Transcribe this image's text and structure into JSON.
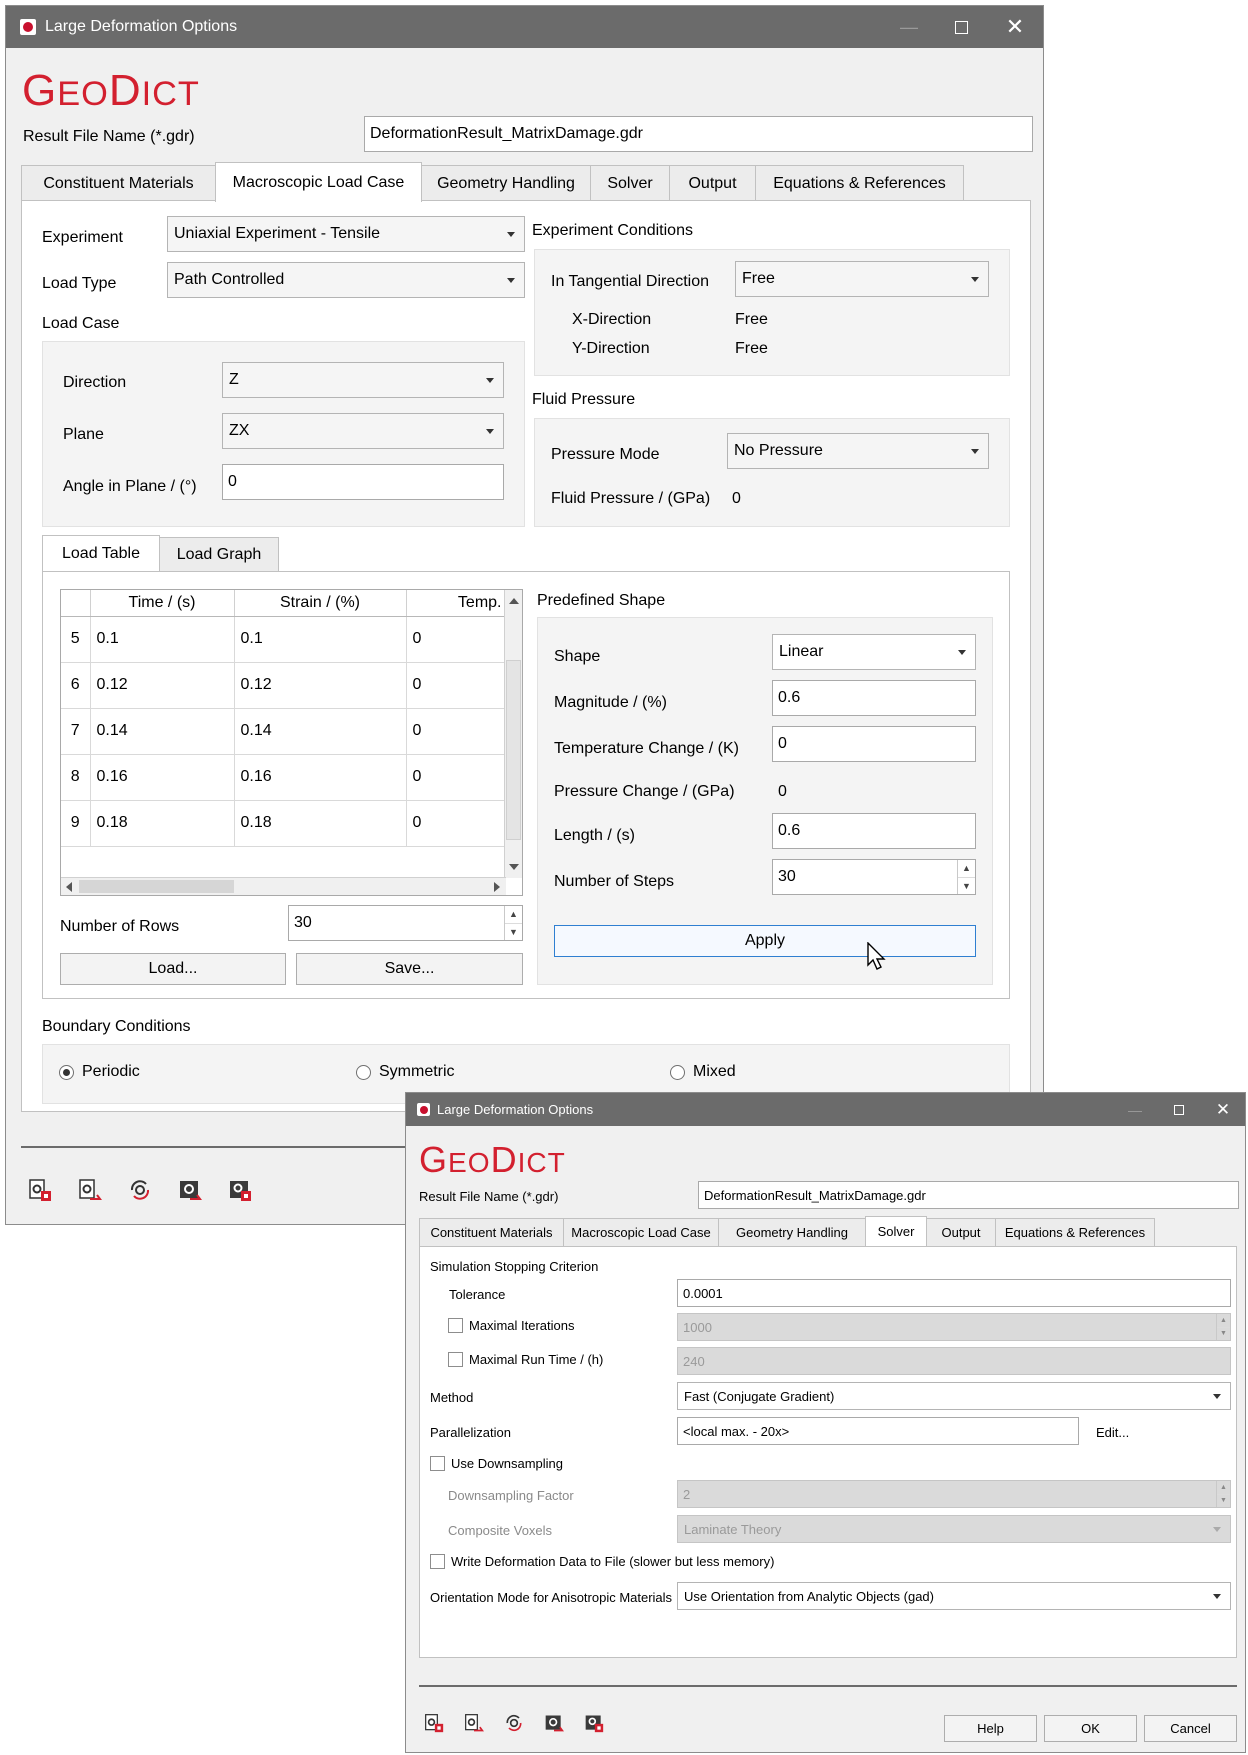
{
  "w1": {
    "title": "Large Deformation Options",
    "logo_big1": "G",
    "logo_small1": "EO",
    "logo_big2": "D",
    "logo_small2": "ICT",
    "result_file_label": "Result File Name (*.gdr)",
    "result_file_value": "DeformationResult_MatrixDamage.gdr",
    "tabs": [
      "Constituent Materials",
      "Macroscopic Load Case",
      "Geometry Handling",
      "Solver",
      "Output",
      "Equations & References"
    ],
    "experiment_label": "Experiment",
    "experiment_value": "Uniaxial Experiment - Tensile",
    "load_type_label": "Load Type",
    "load_type_value": "Path Controlled",
    "load_case_label": "Load Case",
    "direction_label": "Direction",
    "direction_value": "Z",
    "plane_label": "Plane",
    "plane_value": "ZX",
    "angle_label": "Angle in Plane / (°)",
    "angle_value": "0",
    "exp_conditions_label": "Experiment Conditions",
    "tangential_label": "In Tangential Direction",
    "tangential_value": "Free",
    "xdir_label": "X-Direction",
    "xdir_value": "Free",
    "ydir_label": "Y-Direction",
    "ydir_value": "Free",
    "fluid_pressure_group": "Fluid Pressure",
    "pressure_mode_label": "Pressure Mode",
    "pressure_mode_value": "No Pressure",
    "fluid_pressure_label": "Fluid Pressure / (GPa)",
    "fluid_pressure_value": "0",
    "subtabs": [
      "Load Table",
      "Load Graph"
    ],
    "table_headers": [
      "Time / (s)",
      "Strain / (%)",
      "Temp."
    ],
    "table_rows": [
      {
        "n": "5",
        "time": "0.1",
        "strain": "0.1",
        "temp": "0"
      },
      {
        "n": "6",
        "time": "0.12",
        "strain": "0.12",
        "temp": "0"
      },
      {
        "n": "7",
        "time": "0.14",
        "strain": "0.14",
        "temp": "0"
      },
      {
        "n": "8",
        "time": "0.16",
        "strain": "0.16",
        "temp": "0"
      },
      {
        "n": "9",
        "time": "0.18",
        "strain": "0.18",
        "temp": "0"
      }
    ],
    "rows_label": "Number of Rows",
    "rows_value": "30",
    "load_btn": "Load...",
    "save_btn": "Save...",
    "predefined_label": "Predefined Shape",
    "shape_label": "Shape",
    "shape_value": "Linear",
    "magnitude_label": "Magnitude / (%)",
    "magnitude_value": "0.6",
    "temp_change_label": "Temperature Change / (K)",
    "temp_change_value": "0",
    "pressure_change_label": "Pressure Change / (GPa)",
    "pressure_change_value": "0",
    "length_label": "Length / (s)",
    "length_value": "0.6",
    "steps_label": "Number of Steps",
    "steps_value": "30",
    "apply_btn": "Apply",
    "boundary_label": "Boundary Conditions",
    "bc_periodic": "Periodic",
    "bc_symmetric": "Symmetric",
    "bc_mixed": "Mixed"
  },
  "w2": {
    "title": "Large Deformation Options",
    "logo_big1": "G",
    "logo_small1": "EO",
    "logo_big2": "D",
    "logo_small2": "ICT",
    "result_file_label": "Result File Name (*.gdr)",
    "result_file_value": "DeformationResult_MatrixDamage.gdr",
    "tabs": [
      "Constituent Materials",
      "Macroscopic Load Case",
      "Geometry Handling",
      "Solver",
      "Output",
      "Equations & References"
    ],
    "stopping_label": "Simulation Stopping Criterion",
    "tolerance_label": "Tolerance",
    "tolerance_value": "0.0001",
    "max_iter_label": "Maximal Iterations",
    "max_iter_value": "1000",
    "max_time_label": "Maximal Run Time / (h)",
    "max_time_value": "240",
    "method_label": "Method",
    "method_value": "Fast (Conjugate Gradient)",
    "parallel_label": "Parallelization",
    "parallel_value": "<local max. - 20x>",
    "edit_btn": "Edit...",
    "downsampling_label": "Use Downsampling",
    "downsampling_factor_label": "Downsampling Factor",
    "downsampling_factor_value": "2",
    "composite_label": "Composite Voxels",
    "composite_value": "Laminate Theory",
    "write_label": "Write Deformation Data to File (slower but less memory)",
    "orientation_label": "Orientation Mode for Anisotropic Materials",
    "orientation_value": "Use Orientation from Analytic Objects (gad)",
    "help_btn": "Help",
    "ok_btn": "OK",
    "cancel_btn": "Cancel"
  },
  "colors": {
    "brand": "#d3202f",
    "titlebar": "#6b6b6b",
    "focus": "#2f7fd1"
  }
}
